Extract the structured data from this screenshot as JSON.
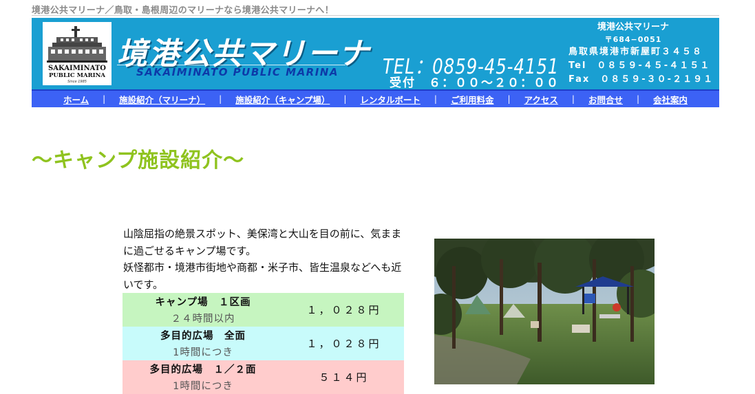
{
  "tagline": "境港公共マリーナ／鳥取・島根周辺のマリーナなら境港公共マリーナへ！",
  "header": {
    "logo_line1": "SAKAIMINATO",
    "logo_line2": "PUBLIC MARINA",
    "logo_line3": "Since 1985",
    "brand_title": "境港公共マリーナ",
    "brand_sub": "SAKAIMINATO PUBLIC MARINA",
    "tel_big": "TEL：0859-45-4151",
    "hours": "受付　６：００〜２０：００",
    "contact": {
      "name": "境港公共マリーナ",
      "zip": "〒684−0051",
      "address": "鳥取県境港市新屋町３４５８",
      "tel": "Tel　０８５９-４５-４１５１",
      "fax": "Fax　０８５９-３０-２１９１"
    }
  },
  "nav": {
    "items": [
      {
        "label": "ホーム"
      },
      {
        "label": "施設紹介（マリーナ）"
      },
      {
        "label": "施設紹介（キャンプ場）"
      },
      {
        "label": "レンタルボート"
      },
      {
        "label": "ご利用料金"
      },
      {
        "label": "アクセス"
      },
      {
        "label": "お問合せ"
      },
      {
        "label": "会社案内"
      }
    ]
  },
  "main": {
    "title": "〜キャンプ施設紹介〜",
    "intro": [
      "山陰屈指の絶景スポット、美保湾と大山を目の前に、気ままに過ごせるキャンプ場です。",
      "妖怪都市・境港市街地や商都・米子市、皆生温泉などへも近いです。"
    ],
    "prices": [
      {
        "name": "キャンプ場　１区画",
        "unit": "２４時間以内",
        "price": "１，０２８円"
      },
      {
        "name": "多目的広場　全面",
        "unit": "1時間につき",
        "price": "１，０２８円"
      },
      {
        "name": "多目的広場　１／２面",
        "unit": "1時間につき",
        "price": "５１４円"
      }
    ]
  },
  "colors": {
    "header_bg": "#1a9fd2",
    "nav_bg": "#3c62f5",
    "title_green": "#8fc31f"
  }
}
